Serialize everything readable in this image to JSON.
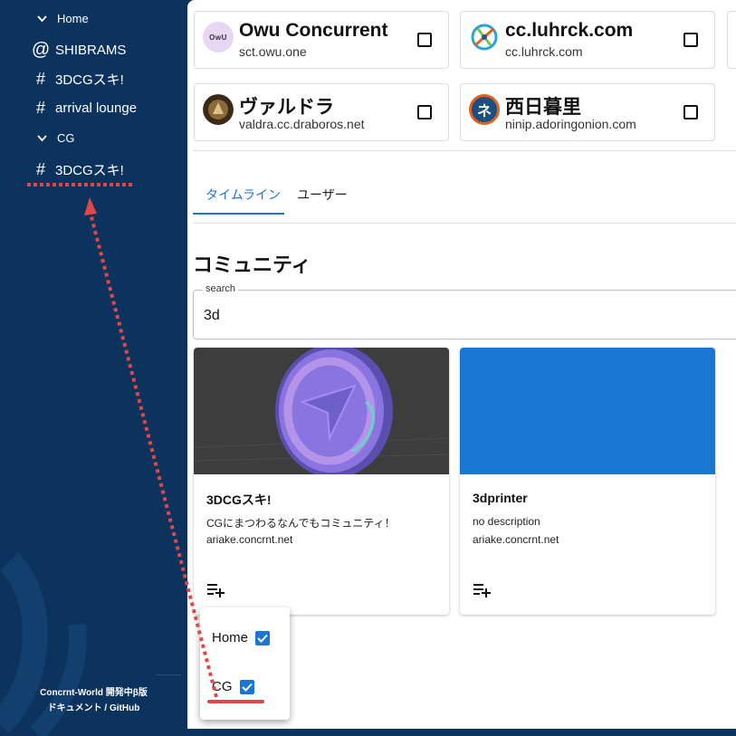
{
  "sidebar": {
    "groups": [
      {
        "label": "Home",
        "icon": "chevron-down-icon"
      },
      {
        "label": "CG",
        "icon": "chevron-down-icon"
      }
    ],
    "home_items": [
      {
        "label": "SHIBRAMS",
        "icon": "at-icon"
      },
      {
        "label": "3DCGスキ!",
        "icon": "hash-icon"
      },
      {
        "label": "arrival lounge",
        "icon": "hash-icon"
      }
    ],
    "cg_items": [
      {
        "label": "3DCGスキ!",
        "icon": "hash-icon"
      }
    ],
    "footer": {
      "line1": "Concrnt-World 開発中β版",
      "line2": "ドキュメント / GitHub"
    }
  },
  "streams": [
    {
      "name": "Owu Concurrent",
      "host": "sct.owu.one",
      "avatar_text": "OwU"
    },
    {
      "name": "cc.luhrck.com",
      "host": "cc.luhrck.com"
    },
    {
      "name": "ヴァルドラ",
      "host": "valdra.cc.draboros.net"
    },
    {
      "name": "西日暮里",
      "host": "ninip.adoringonion.com",
      "avatar_text": "ネ"
    }
  ],
  "tabs": [
    {
      "label": "タイムライン",
      "active": true
    },
    {
      "label": "ユーザー",
      "active": false
    }
  ],
  "section_heading": "コミュニティ",
  "search": {
    "label": "search",
    "value": "3d"
  },
  "communities": [
    {
      "name": "3DCGスキ!",
      "description": "CGにまつわるなんでもコミュニティ！",
      "host": "ariake.concrnt.net"
    },
    {
      "name": "3dprinter",
      "description": "no description",
      "host": "ariake.concrnt.net"
    }
  ],
  "popup": {
    "options": [
      {
        "label": "Home",
        "checked": true
      },
      {
        "label": "CG",
        "checked": true
      }
    ]
  },
  "colors": {
    "sidebar_bg": "#0b335d",
    "accent": "#1976d2",
    "annotation": "#e04848"
  }
}
